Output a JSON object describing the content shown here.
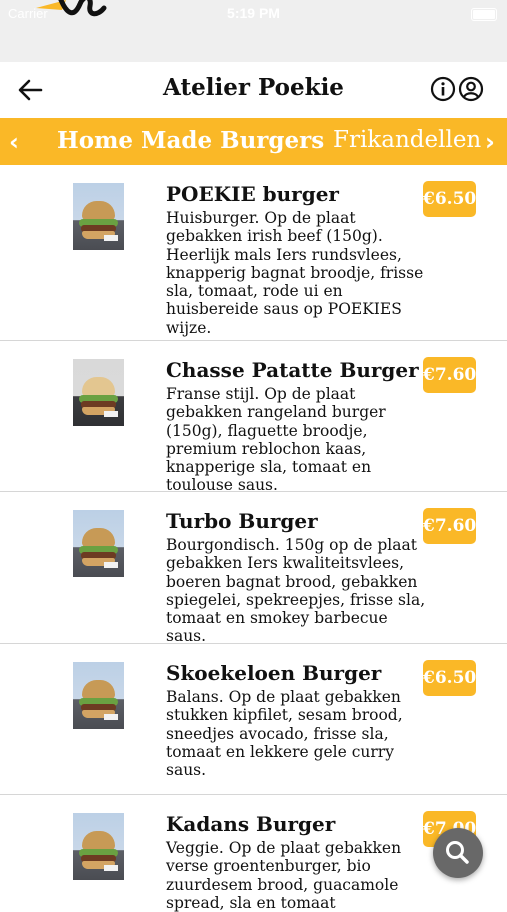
{
  "status_bar": {
    "carrier": "Carrier",
    "time": "5:19 PM"
  },
  "header": {
    "title": "Atelier Poekie",
    "back_icon": "arrow-left-icon",
    "info_icon": "info-icon",
    "account_icon": "user-circle-icon"
  },
  "categories": {
    "active": "Home Made Burgers",
    "next": "Frikandellen",
    "left_arrow": "‹",
    "right_arrow": "›"
  },
  "colors": {
    "accent": "#fab827",
    "fab": "#686868",
    "divider": "#d6d6d6"
  },
  "items": [
    {
      "name": "POEKIE burger",
      "description": "Huisburger. Op de plaat gebakken irish beef (150g). Heerlijk mals Iers rundsvlees, knapperig bagnat broodje, frisse sla, tomaat, rode ui en huisbereide saus op POEKIES wijze.",
      "price": "€6.50"
    },
    {
      "name": "Chasse Patatte Burger",
      "description": "Franse stijl. Op de plaat gebakken rangeland burger (150g), flaguette broodje, premium reblochon kaas, knapperige sla, tomaat en toulouse saus.",
      "price": "€7.60"
    },
    {
      "name": "Turbo Burger",
      "description": "Bourgondisch. 150g op de plaat gebakken Iers kwaliteitsvlees, boeren bagnat brood, gebakken spiegelei, spekreepjes, frisse sla, tomaat en smokey barbecue saus.",
      "price": "€7.60"
    },
    {
      "name": "Skoekeloen Burger",
      "description": "Balans. Op de plaat gebakken stukken kipfilet, sesam brood, sneedjes avocado, frisse sla, tomaat en lekkere gele curry saus.",
      "price": "€6.50"
    },
    {
      "name": "Kadans Burger",
      "description": "Veggie. Op de plaat gebakken verse groentenburger, bio zuurdesem brood, guacamole spread, sla en tomaat",
      "price": "€7.00"
    }
  ],
  "fab": {
    "icon": "search-icon"
  }
}
